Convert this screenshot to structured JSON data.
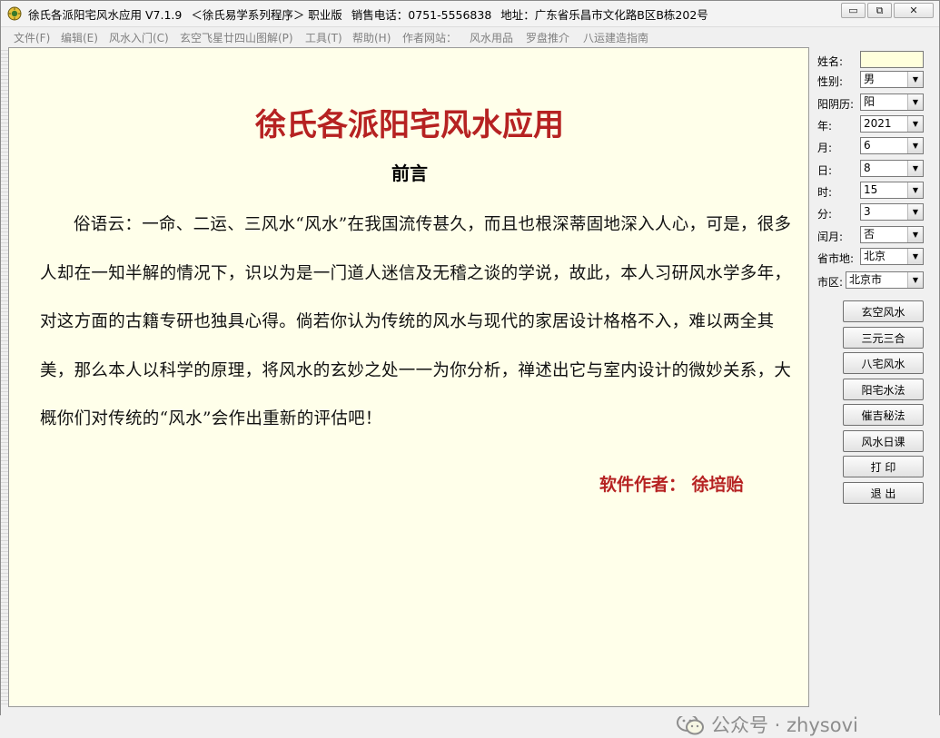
{
  "window": {
    "title_parts": [
      "徐氏各派阳宅风水应用 V7.1.9",
      "＜徐氏易学系列程序＞ 职业版",
      "销售电话：0751-5556838",
      "地址：广东省乐昌市文化路B区B栋202号"
    ],
    "controls": {
      "minimize": "▭",
      "maximize": "⧉",
      "close": "✕"
    }
  },
  "menu": {
    "items": [
      "文件(F)",
      "编辑(E)",
      "风水入门(C)",
      "玄空飞星廿四山图解(P)",
      "工具(T)",
      "帮助(H)",
      "作者网站：",
      "风水用品",
      "罗盘推介",
      "八运建造指南"
    ]
  },
  "content": {
    "title": "徐氏各派阳宅风水应用",
    "subtitle": "前言",
    "paragraph": "俗语云：一命、二运、三风水“风水”在我国流传甚久，而且也根深蒂固地深入人心，可是，很多人却在一知半解的情况下，识以为是一门道人迷信及无稽之谈的学说，故此，本人习研风水学多年，对这方面的古籍专研也独具心得。倘若你认为传统的风水与现代的家居设计格格不入，难以两全其美，那么本人以科学的原理，将风水的玄妙之处一一为你分析，禅述出它与室内设计的微妙关系，大概你们对传统的“风水”会作出重新的评估吧！",
    "author": "软件作者：  徐培贻"
  },
  "form": {
    "name_label": "姓名:",
    "name_value": "",
    "gender_label": "性别:",
    "gender_value": "男",
    "calendar_label": "阳阴历:",
    "calendar_value": "阳",
    "year_label": "年:",
    "year_value": "2021",
    "month_label": "月:",
    "month_value": "6",
    "day_label": "日:",
    "day_value": "8",
    "hour_label": "时:",
    "hour_value": "15",
    "minute_label": "分:",
    "minute_value": "3",
    "leap_label": "闰月:",
    "leap_value": "否",
    "province_label": "省市地:",
    "province_value": "北京",
    "district_label": "市区:",
    "district_value": "北京市"
  },
  "buttons": [
    "玄空风水",
    "三元三合",
    "八宅风水",
    "阳宅水法",
    "催吉秘法",
    "风水日课",
    "打 印",
    "退 出"
  ],
  "watermark": {
    "text": "公众号 · zhysovi"
  },
  "colors": {
    "accent_red": "#b62222",
    "paper": "#ffffea"
  }
}
